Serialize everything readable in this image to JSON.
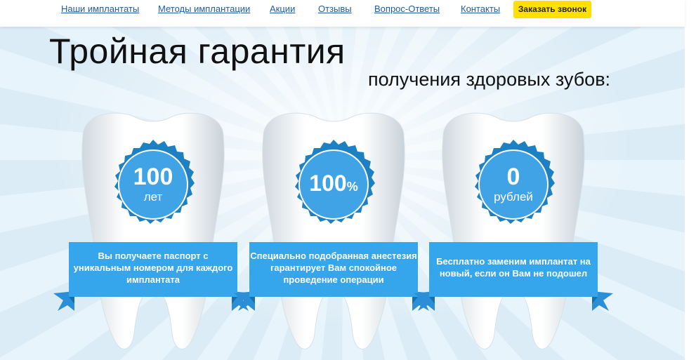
{
  "nav": {
    "links": [
      {
        "label": "Наши имплантаты"
      },
      {
        "label": "Методы имплантации"
      },
      {
        "label": "Акции"
      },
      {
        "label": "Отзывы"
      },
      {
        "label": "Вопрос-Ответы"
      },
      {
        "label": "Контакты"
      }
    ],
    "call_button": "Заказать звонок"
  },
  "hero": {
    "title": "Тройная гарантия",
    "subtitle": "получения здоровых зубов:"
  },
  "cards": [
    {
      "value": "100",
      "unit": "лет",
      "text": "Вы получаете паспорт с уникальным номером для каждого имплантата"
    },
    {
      "value": "100",
      "unit": "%",
      "text": "Специально подобранная анестезия гарантирует Вам спокойное проведение операции"
    },
    {
      "value": "0",
      "unit": "рублей",
      "text": "Бесплатно заменим имплантат на новый, если он Вам не подошел"
    }
  ],
  "colors": {
    "accent_blue": "#2da0e6",
    "button_yellow": "#ffe000",
    "link_blue": "#1f5c9e"
  }
}
